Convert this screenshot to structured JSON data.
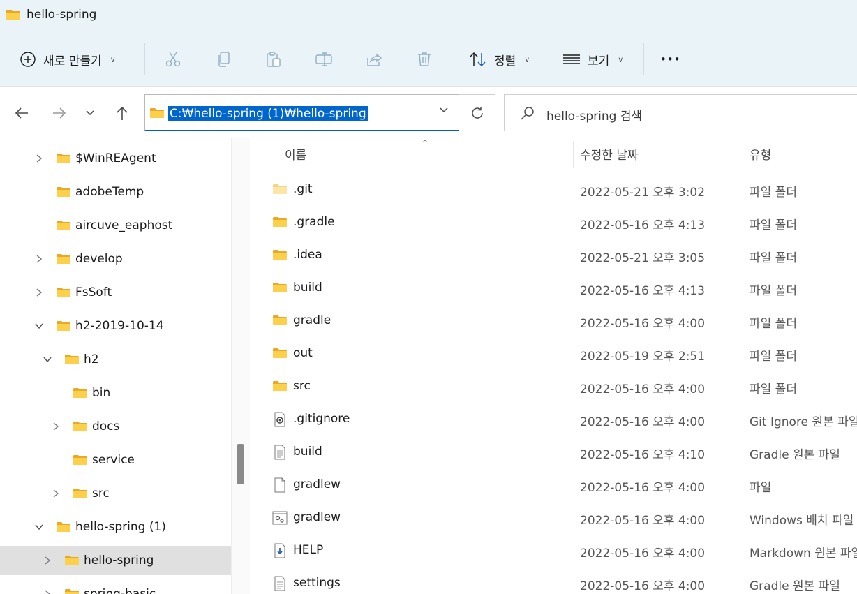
{
  "window": {
    "title": "hello-spring"
  },
  "toolbar": {
    "new_label": "새로 만들기",
    "sort_label": "정렬",
    "view_label": "보기",
    "more_label": "•••"
  },
  "address": {
    "path": "C:₩hello-spring (1)₩hello-spring"
  },
  "search": {
    "placeholder": "hello-spring 검색"
  },
  "sidebar": {
    "items": [
      {
        "label": "$WinREAgent",
        "expandable": true,
        "expanded": false,
        "level": 0
      },
      {
        "label": "adobeTemp",
        "expandable": false,
        "expanded": false,
        "level": 0
      },
      {
        "label": "aircuve_eaphost",
        "expandable": false,
        "expanded": false,
        "level": 0
      },
      {
        "label": "develop",
        "expandable": true,
        "expanded": false,
        "level": 0
      },
      {
        "label": "FsSoft",
        "expandable": true,
        "expanded": false,
        "level": 0
      },
      {
        "label": "h2-2019-10-14",
        "expandable": true,
        "expanded": true,
        "level": 0
      },
      {
        "label": "h2",
        "expandable": true,
        "expanded": true,
        "level": 1
      },
      {
        "label": "bin",
        "expandable": false,
        "expanded": false,
        "level": 2
      },
      {
        "label": "docs",
        "expandable": true,
        "expanded": false,
        "level": 2
      },
      {
        "label": "service",
        "expandable": false,
        "expanded": false,
        "level": 2
      },
      {
        "label": "src",
        "expandable": true,
        "expanded": false,
        "level": 2
      },
      {
        "label": "hello-spring (1)",
        "expandable": true,
        "expanded": true,
        "level": 0
      },
      {
        "label": "hello-spring",
        "expandable": true,
        "expanded": false,
        "level": 1,
        "selected": true
      },
      {
        "label": "spring-basic",
        "expandable": true,
        "expanded": false,
        "level": 1
      }
    ]
  },
  "columns": {
    "name": "이름",
    "date": "수정한 날짜",
    "type": "유형"
  },
  "files": [
    {
      "name": ".git",
      "date": "2022-05-21 오후 3:02",
      "type": "파일 폴더",
      "icon": "folder-light-icon"
    },
    {
      "name": ".gradle",
      "date": "2022-05-16 오후 4:13",
      "type": "파일 폴더",
      "icon": "folder-icon"
    },
    {
      "name": ".idea",
      "date": "2022-05-21 오후 3:05",
      "type": "파일 폴더",
      "icon": "folder-icon"
    },
    {
      "name": "build",
      "date": "2022-05-16 오후 4:13",
      "type": "파일 폴더",
      "icon": "folder-icon"
    },
    {
      "name": "gradle",
      "date": "2022-05-16 오후 4:00",
      "type": "파일 폴더",
      "icon": "folder-icon"
    },
    {
      "name": "out",
      "date": "2022-05-19 오후 2:51",
      "type": "파일 폴더",
      "icon": "folder-icon"
    },
    {
      "name": "src",
      "date": "2022-05-16 오후 4:00",
      "type": "파일 폴더",
      "icon": "folder-icon"
    },
    {
      "name": ".gitignore",
      "date": "2022-05-16 오후 4:00",
      "type": "Git Ignore 원본 파일",
      "icon": "config-file-icon"
    },
    {
      "name": "build",
      "date": "2022-05-16 오후 4:10",
      "type": "Gradle 원본 파일",
      "icon": "text-file-icon"
    },
    {
      "name": "gradlew",
      "date": "2022-05-16 오후 4:00",
      "type": "파일",
      "icon": "blank-file-icon"
    },
    {
      "name": "gradlew",
      "date": "2022-05-16 오후 4:00",
      "type": "Windows 배치 파일",
      "icon": "batch-file-icon"
    },
    {
      "name": "HELP",
      "date": "2022-05-16 오후 4:00",
      "type": "Markdown 원본 파일",
      "icon": "markdown-file-icon"
    },
    {
      "name": "settings",
      "date": "2022-05-16 오후 4:00",
      "type": "Gradle 원본 파일",
      "icon": "text-file-icon"
    }
  ],
  "colors": {
    "accent": "#005fb8",
    "selection": "#0066cc",
    "folder": "#f8c33b",
    "titlebar": "#eaf4f8"
  }
}
